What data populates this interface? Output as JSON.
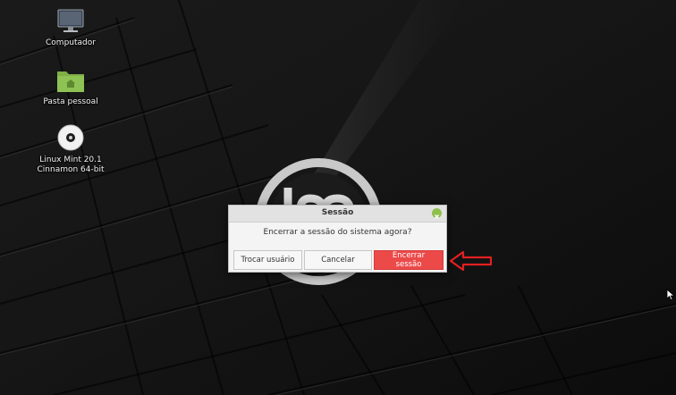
{
  "desktop": {
    "icons": [
      {
        "label": "Computador",
        "icon": "computer-icon"
      },
      {
        "label": "Pasta pessoal",
        "icon": "home-folder-icon"
      },
      {
        "label_line1": "Linux Mint 20.1",
        "label_line2": "Cinnamon 64-bit",
        "icon": "optical-disc-icon"
      }
    ]
  },
  "dialog": {
    "title": "Sessão",
    "message": "Encerrar a sessão do sistema agora?",
    "buttons": {
      "switch_user": "Trocar usuário",
      "cancel": "Cancelar",
      "logout": "Encerrar sessão"
    }
  },
  "colors": {
    "logout_button": "#ec4949",
    "annotation_arrow": "#e02020",
    "close_button": "#8fbf4d"
  }
}
